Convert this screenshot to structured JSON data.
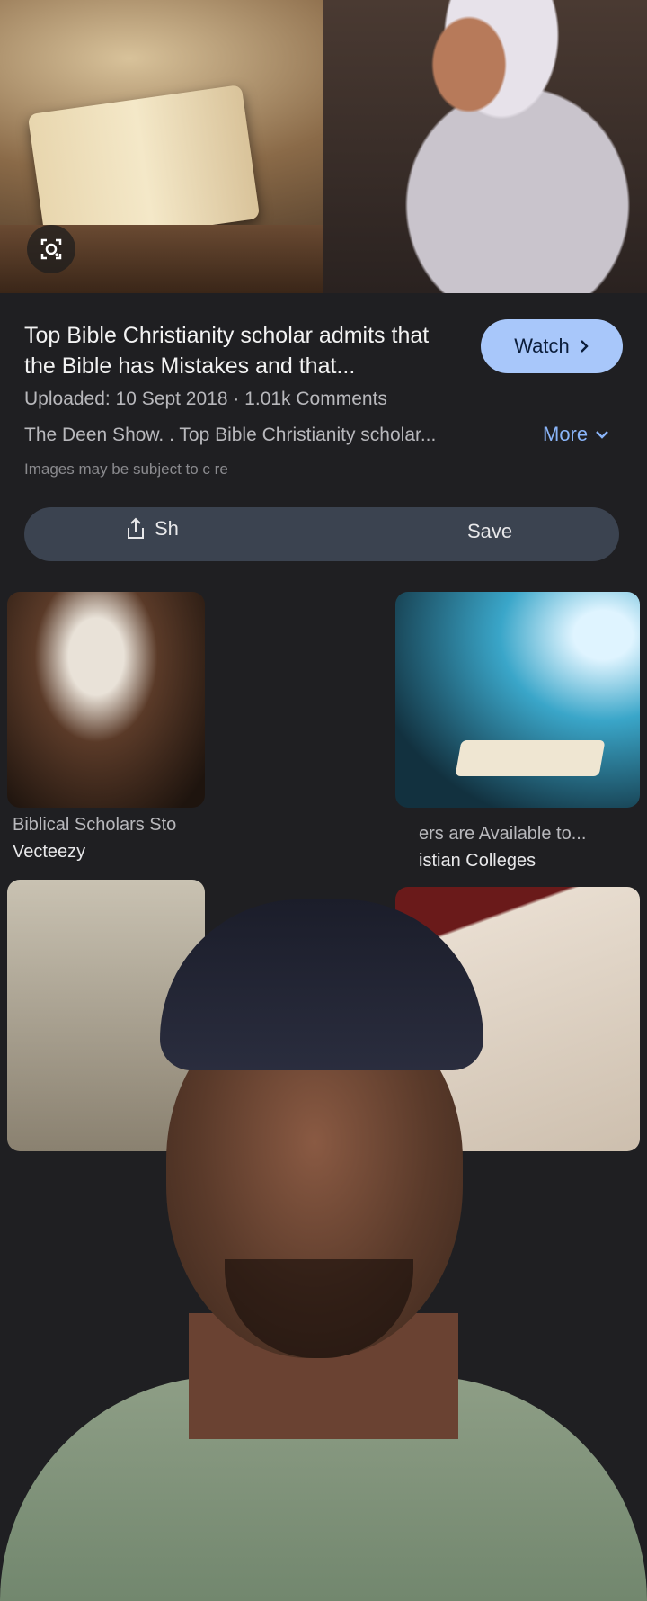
{
  "result": {
    "title": "Top Bible Christianity scholar admits that the Bible has Mistakes and that...",
    "watch_label": "Watch",
    "uploaded": "Uploaded: 10 Sept 2018 · 1.01k Comments",
    "source_line": "The Deen Show. . Top Bible Christianity scholar...",
    "more_label": "More",
    "disclaimer": "Images may be subject to c                    re",
    "share_label": "Sh",
    "save_label": "Save"
  },
  "related": [
    {
      "caption": "Biblical Scholars Sto",
      "source": "Vecteezy"
    },
    {
      "caption": "ers are Available to...",
      "source": "istian Colleges"
    }
  ],
  "icons": {
    "lens": "google-lens-icon",
    "watch_chevron": "chevron-right-icon",
    "more_chevron": "chevron-down-icon",
    "share": "share-icon"
  }
}
